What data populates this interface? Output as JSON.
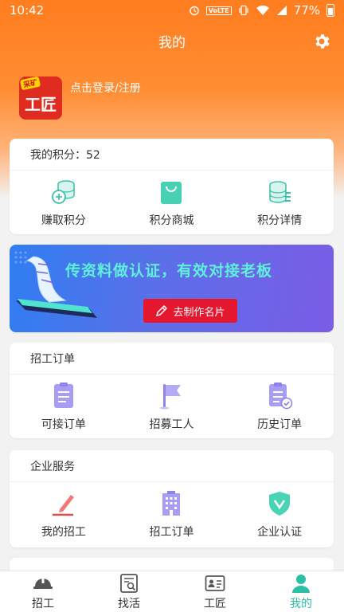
{
  "status_bar": {
    "time": "10:42",
    "volte": "VoLTE",
    "battery": "77%"
  },
  "header": {
    "title": "我的"
  },
  "profile": {
    "login_text": "点击登录/注册",
    "logo_text": "工匠",
    "logo_badge": "采矿"
  },
  "points": {
    "label": "我的积分：52",
    "items": [
      {
        "label": "赚取积分",
        "icon": "coins-plus-icon"
      },
      {
        "label": "积分商城",
        "icon": "shopping-bag-icon"
      },
      {
        "label": "积分详情",
        "icon": "coins-list-icon"
      }
    ]
  },
  "banner": {
    "headline": "传资料做认证，有效对接老板",
    "button": "去制作名片"
  },
  "recruit_orders": {
    "title": "招工订单",
    "items": [
      {
        "label": "可接订单",
        "icon": "order-list-icon"
      },
      {
        "label": "招募工人",
        "icon": "flag-icon"
      },
      {
        "label": "历史订单",
        "icon": "order-history-icon"
      }
    ]
  },
  "enterprise": {
    "title": "企业服务",
    "items": [
      {
        "label": "我的招工",
        "icon": "pen-icon"
      },
      {
        "label": "招工订单",
        "icon": "building-icon"
      },
      {
        "label": "企业认证",
        "icon": "shield-check-icon"
      }
    ]
  },
  "tabbar": {
    "items": [
      {
        "label": "招工",
        "icon": "helmet-icon",
        "active": false
      },
      {
        "label": "找活",
        "icon": "search-doc-icon",
        "active": false
      },
      {
        "label": "工匠",
        "icon": "id-card-icon",
        "active": false
      },
      {
        "label": "我的",
        "icon": "person-icon",
        "active": true
      }
    ]
  },
  "colors": {
    "brand_orange": "#ff7d1f",
    "accent_teal": "#2dbfa6",
    "banner_button": "#e5172f"
  }
}
